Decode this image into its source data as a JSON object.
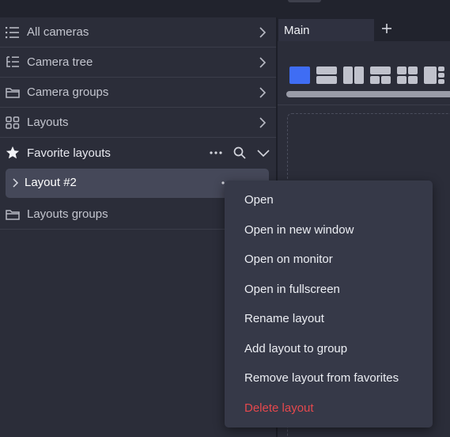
{
  "sidebar": {
    "items": [
      {
        "label": "All cameras",
        "icon": "list-icon"
      },
      {
        "label": "Camera tree",
        "icon": "tree-icon"
      },
      {
        "label": "Camera groups",
        "icon": "folder-icon"
      },
      {
        "label": "Layouts",
        "icon": "grid-icon"
      }
    ],
    "favorites": {
      "label": "Favorite layouts",
      "icon": "star-icon",
      "layout_item": "Layout #2"
    },
    "layouts_groups": {
      "label": "Layouts groups",
      "icon": "folder-icon"
    }
  },
  "tabs": {
    "main_label": "Main",
    "add_icon": "plus-icon"
  },
  "context_menu": {
    "items": [
      {
        "label": "Open"
      },
      {
        "label": "Open in new window"
      },
      {
        "label": "Open on monitor"
      },
      {
        "label": "Open in fullscreen"
      },
      {
        "label": "Rename layout"
      },
      {
        "label": "Add layout to group"
      },
      {
        "label": "Remove layout from favorites"
      },
      {
        "label": "Delete layout",
        "danger": true
      }
    ]
  },
  "colors": {
    "accent": "#3f6df4",
    "danger": "#e5484d",
    "background": "#2b2d39",
    "menu_background": "#363948",
    "selected_item": "#454859"
  }
}
